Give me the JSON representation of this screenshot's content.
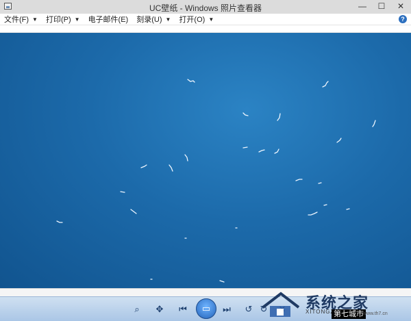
{
  "window": {
    "title": "UC壁纸 - Windows 照片查看器"
  },
  "window_buttons": {
    "minimize": "—",
    "maximize": "☐",
    "close": "✕"
  },
  "menu": {
    "items": [
      {
        "label": "文件(F)"
      },
      {
        "label": "打印(P)"
      },
      {
        "label": "电子邮件(E)"
      },
      {
        "label": "刻录(U)"
      },
      {
        "label": "打开(O)"
      }
    ],
    "help": "?"
  },
  "image": {
    "description_colors": {
      "sky": "#1c6aaa",
      "birds": "#ffffff"
    }
  },
  "controls": {
    "zoom_icon": "⌕",
    "fit_icon": "✥",
    "prev_icon": "⏮",
    "play_icon": "▭",
    "next_icon": "⏭",
    "rotate_left_icon": "↺",
    "rotate_right_icon": "↻",
    "delete_icon": "✕"
  },
  "watermark": {
    "brand": "系统之家",
    "sub": "XITONGZHIJIA",
    "city": "第七城市",
    "url": "www.th7.cn"
  }
}
